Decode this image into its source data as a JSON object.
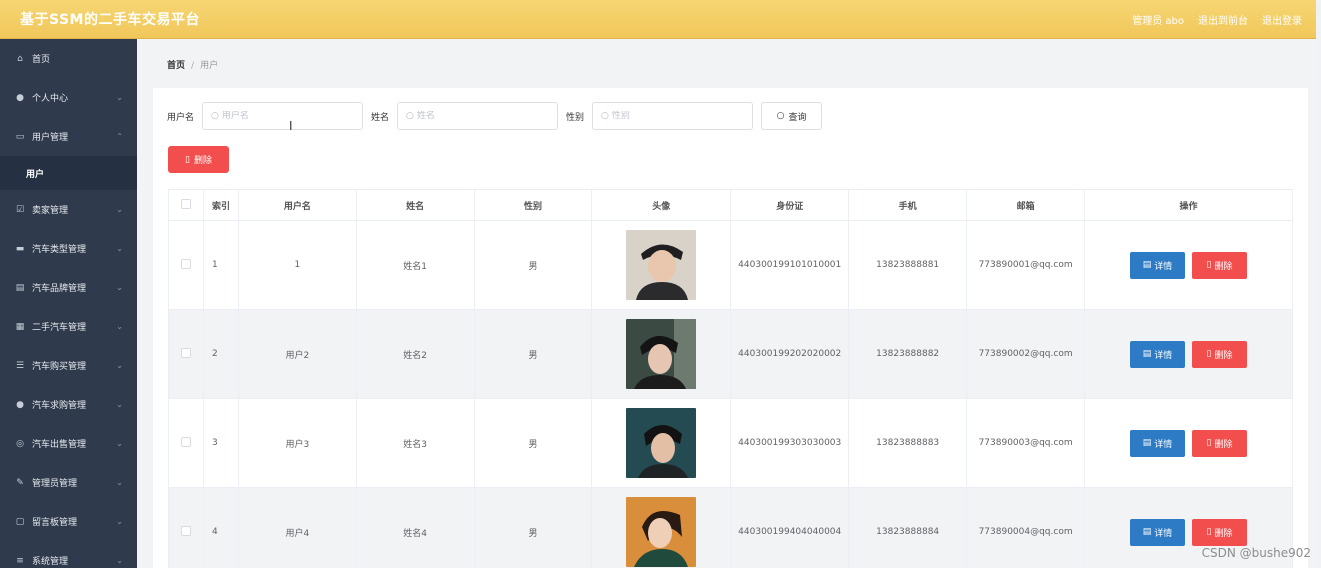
{
  "header": {
    "title": "基于SSM的二手车交易平台",
    "admin_label": "管理员 abo",
    "back_label": "退出到前台",
    "logout_label": "退出登录"
  },
  "sidebar": {
    "items": [
      {
        "label": "首页",
        "icon": "home-icon"
      },
      {
        "label": "个人中心",
        "icon": "user-icon"
      },
      {
        "label": "用户管理",
        "icon": "users-icon"
      },
      {
        "label": "卖家管理",
        "icon": "check-icon"
      },
      {
        "label": "汽车类型管理",
        "icon": "chat-icon"
      },
      {
        "label": "汽车品牌管理",
        "icon": "doc-icon"
      },
      {
        "label": "二手汽车管理",
        "icon": "grid-icon"
      },
      {
        "label": "汽车购买管理",
        "icon": "sliders-icon"
      },
      {
        "label": "汽车求购管理",
        "icon": "pin-icon"
      },
      {
        "label": "汽车出售管理",
        "icon": "globe-icon"
      },
      {
        "label": "管理员管理",
        "icon": "pen-icon"
      },
      {
        "label": "留言板管理",
        "icon": "message-icon"
      },
      {
        "label": "系统管理",
        "icon": "menu-icon"
      }
    ],
    "active_sub": "用户"
  },
  "breadcrumb": {
    "home": "首页",
    "current": "用户"
  },
  "search": {
    "username_label": "用户名",
    "username_placeholder": "用户名",
    "name_label": "姓名",
    "name_placeholder": "姓名",
    "gender_label": "性别",
    "gender_placeholder": "性别",
    "query_label": "查询"
  },
  "actions": {
    "delete_label": "删除"
  },
  "table": {
    "columns": [
      "索引",
      "用户名",
      "姓名",
      "性别",
      "头像",
      "身份证",
      "手机",
      "邮箱",
      "操作"
    ],
    "detail_label": "详情",
    "delete_label": "删除",
    "rows": [
      {
        "index": "1",
        "username": "1",
        "name": "姓名1",
        "gender": "男",
        "idcard": "440300199101010001",
        "phone": "13823888881",
        "email": "773890001@qq.com"
      },
      {
        "index": "2",
        "username": "用户2",
        "name": "姓名2",
        "gender": "男",
        "idcard": "440300199202020002",
        "phone": "13823888882",
        "email": "773890002@qq.com"
      },
      {
        "index": "3",
        "username": "用户3",
        "name": "姓名3",
        "gender": "男",
        "idcard": "440300199303030003",
        "phone": "13823888883",
        "email": "773890003@qq.com"
      },
      {
        "index": "4",
        "username": "用户4",
        "name": "姓名4",
        "gender": "男",
        "idcard": "440300199404040004",
        "phone": "13823888884",
        "email": "773890004@qq.com"
      }
    ]
  },
  "watermark": "CSDN @bushe902",
  "colors": {
    "topbar": "#f1c75a",
    "sidebar": "#2f3b4c",
    "primary": "#2d7bc4",
    "danger": "#f24e4e"
  }
}
